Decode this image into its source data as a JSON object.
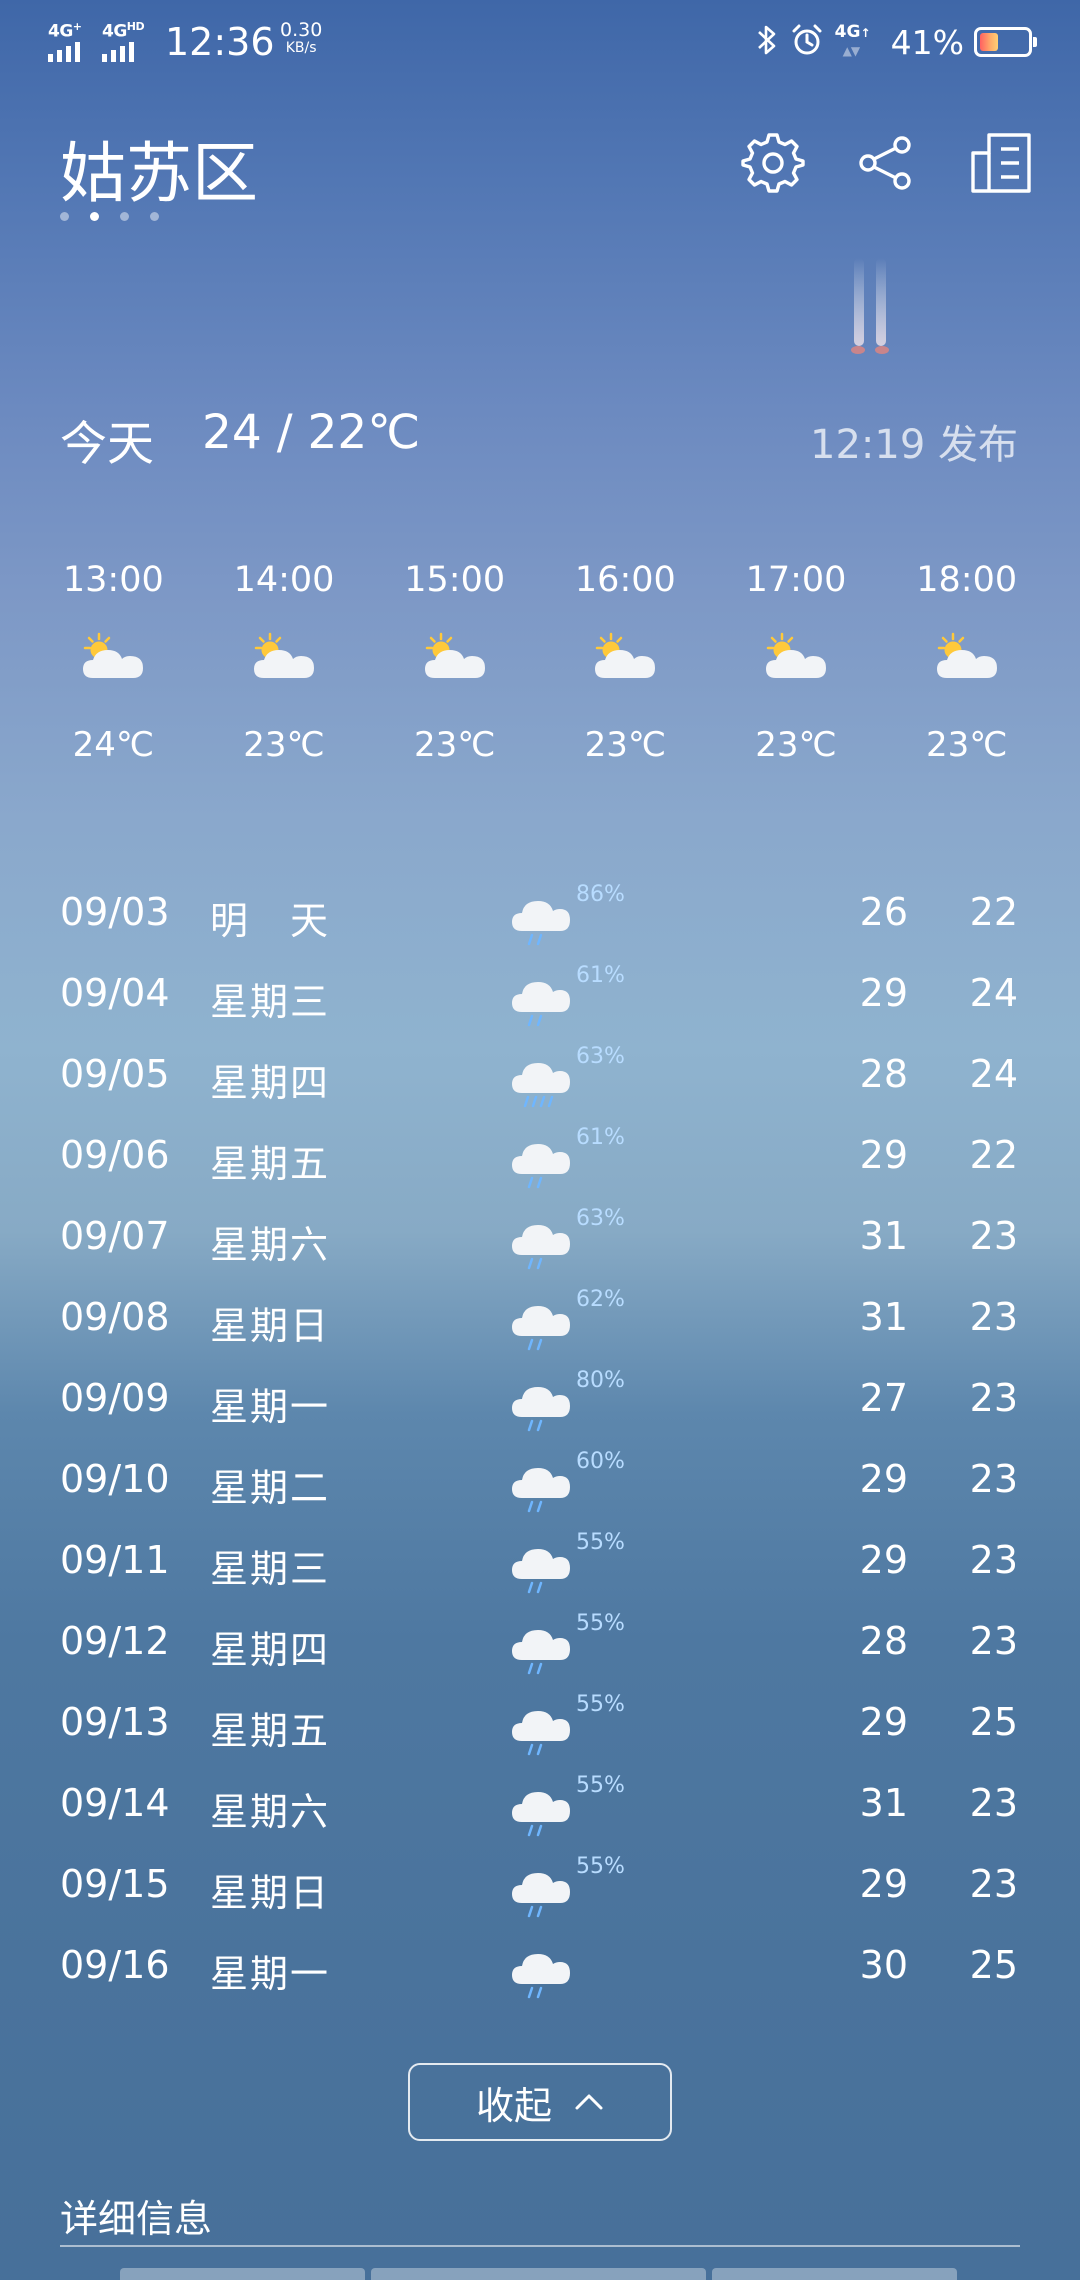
{
  "status_bar": {
    "sim1": "4G",
    "sim1_sup": "+",
    "sim2": "4G",
    "sim2_sup": "HD",
    "time": "12:36",
    "net_speed_value": "0.30",
    "net_speed_unit": "KB/s",
    "sim3": "4G",
    "battery_pct": "41%",
    "battery_level": 0.41,
    "icons": [
      "bluetooth-icon",
      "alarm-icon"
    ]
  },
  "header": {
    "city": "姑苏区",
    "page_count": 4,
    "active_page": 2,
    "icons": [
      "gear-icon",
      "share-icon",
      "city-list-icon"
    ]
  },
  "today": {
    "label": "今天",
    "range": "24 / 22℃",
    "published": "12:19 发布"
  },
  "hourly": [
    {
      "time": "13:00",
      "icon": "partly-cloudy-icon",
      "temp": "24℃"
    },
    {
      "time": "14:00",
      "icon": "partly-cloudy-icon",
      "temp": "23℃"
    },
    {
      "time": "15:00",
      "icon": "partly-cloudy-icon",
      "temp": "23℃"
    },
    {
      "time": "16:00",
      "icon": "partly-cloudy-icon",
      "temp": "23℃"
    },
    {
      "time": "17:00",
      "icon": "partly-cloudy-icon",
      "temp": "23℃"
    },
    {
      "time": "18:00",
      "icon": "partly-cloudy-icon",
      "temp": "23℃"
    }
  ],
  "daily": [
    {
      "date": "09/03",
      "weekday": "明　天",
      "icon": "rain-cloud-icon",
      "pop": "86%",
      "high": "26",
      "low": "22"
    },
    {
      "date": "09/04",
      "weekday": "星期三",
      "icon": "rain-cloud-icon",
      "pop": "61%",
      "high": "29",
      "low": "24"
    },
    {
      "date": "09/05",
      "weekday": "星期四",
      "icon": "heavy-rain-cloud-icon",
      "pop": "63%",
      "high": "28",
      "low": "24"
    },
    {
      "date": "09/06",
      "weekday": "星期五",
      "icon": "rain-cloud-icon",
      "pop": "61%",
      "high": "29",
      "low": "22"
    },
    {
      "date": "09/07",
      "weekday": "星期六",
      "icon": "rain-cloud-icon",
      "pop": "63%",
      "high": "31",
      "low": "23"
    },
    {
      "date": "09/08",
      "weekday": "星期日",
      "icon": "rain-cloud-icon",
      "pop": "62%",
      "high": "31",
      "low": "23"
    },
    {
      "date": "09/09",
      "weekday": "星期一",
      "icon": "rain-cloud-icon",
      "pop": "80%",
      "high": "27",
      "low": "23"
    },
    {
      "date": "09/10",
      "weekday": "星期二",
      "icon": "rain-cloud-icon",
      "pop": "60%",
      "high": "29",
      "low": "23"
    },
    {
      "date": "09/11",
      "weekday": "星期三",
      "icon": "rain-cloud-icon",
      "pop": "55%",
      "high": "29",
      "low": "23"
    },
    {
      "date": "09/12",
      "weekday": "星期四",
      "icon": "rain-cloud-icon",
      "pop": "55%",
      "high": "28",
      "low": "23"
    },
    {
      "date": "09/13",
      "weekday": "星期五",
      "icon": "rain-cloud-icon",
      "pop": "55%",
      "high": "29",
      "low": "25"
    },
    {
      "date": "09/14",
      "weekday": "星期六",
      "icon": "rain-cloud-icon",
      "pop": "55%",
      "high": "31",
      "low": "23"
    },
    {
      "date": "09/15",
      "weekday": "星期日",
      "icon": "rain-cloud-icon",
      "pop": "55%",
      "high": "29",
      "low": "23"
    },
    {
      "date": "09/16",
      "weekday": "星期一",
      "icon": "rain-cloud-icon",
      "pop": "",
      "high": "30",
      "low": "25"
    }
  ],
  "collapse_button": {
    "label": "收起",
    "icon": "chevron-up-icon"
  },
  "details": {
    "title": "详细信息"
  },
  "colors": {
    "rain_drop": "#6fb6ff",
    "sun": "#ffc93a",
    "cloud": "#f2f4f7",
    "pop_text": "#b8dcff"
  }
}
